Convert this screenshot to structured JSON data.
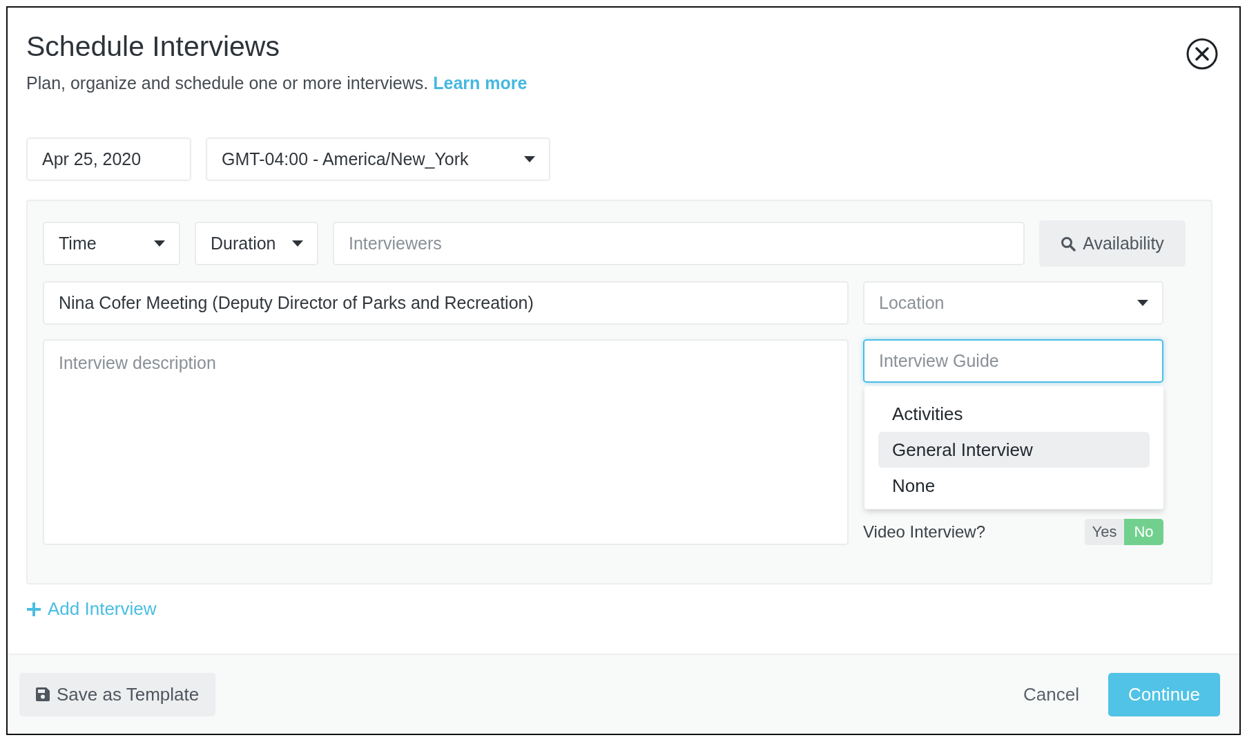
{
  "dialog": {
    "title": "Schedule Interviews",
    "subtitle": "Plan, organize and schedule one or more interviews.",
    "learn_more_link": "Learn more"
  },
  "date_field": {
    "value": "Apr 25, 2020"
  },
  "timezone_select": {
    "value": "GMT-04:00 - America/New_York"
  },
  "interview": {
    "time_select": {
      "value": "Time"
    },
    "duration_select": {
      "value": "Duration"
    },
    "interviewers_field": {
      "placeholder": "Interviewers"
    },
    "availability_button": "Availability",
    "title_field": {
      "value": "Nina Cofer Meeting (Deputy Director of Parks and Recreation)"
    },
    "location_select": {
      "placeholder": "Location"
    },
    "description_field": {
      "placeholder": "Interview description"
    },
    "interview_guide": {
      "placeholder": "Interview Guide",
      "focused": true,
      "options": [
        {
          "label": "Activities",
          "selected": false
        },
        {
          "label": "General Interview",
          "selected": true
        },
        {
          "label": "None",
          "selected": false
        }
      ]
    },
    "video_interview": {
      "label": "Video Interview?",
      "options": [
        {
          "label": "Yes",
          "selected": false
        },
        {
          "label": "No",
          "selected": true
        }
      ]
    }
  },
  "add_interview_link": "Add Interview",
  "footer": {
    "save_template_button": "Save as Template",
    "cancel_button": "Cancel",
    "continue_button": "Continue"
  }
}
